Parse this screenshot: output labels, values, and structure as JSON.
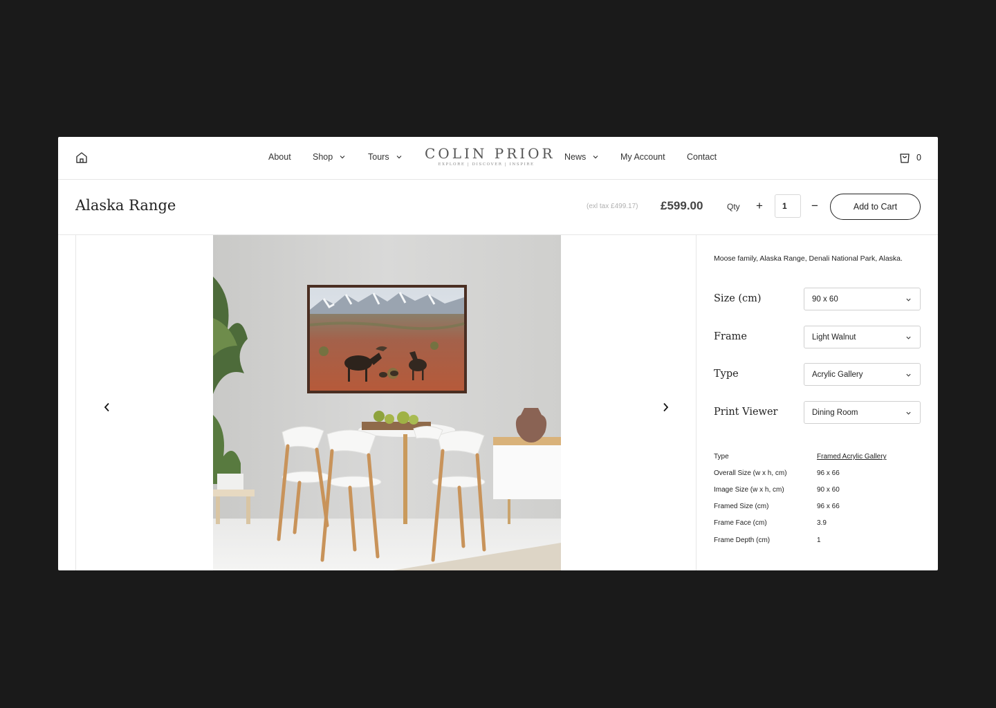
{
  "header": {
    "nav_left": [
      "About",
      "Shop",
      "Tours"
    ],
    "logo_title": "COLIN PRIOR",
    "logo_tagline": "EXPLORE | DISCOVER | INSPIRE",
    "nav_right": [
      "News",
      "My Account",
      "Contact"
    ],
    "cart_count": "0"
  },
  "product": {
    "title": "Alaska Range",
    "ex_tax": "(exl tax £499.17)",
    "price": "£599.00",
    "qty_label": "Qty",
    "qty_plus": "+",
    "qty_value": "1",
    "qty_minus": "−",
    "add_to_cart": "Add to Cart"
  },
  "sidebar": {
    "description": "Moose family, Alaska Range, Denali National Park, Alaska.",
    "options": [
      {
        "label": "Size (cm)",
        "value": "90 x 60"
      },
      {
        "label": "Frame",
        "value": "Light Walnut"
      },
      {
        "label": "Type",
        "value": "Acrylic Gallery"
      },
      {
        "label": "Print Viewer",
        "value": "Dining Room"
      }
    ],
    "specs": [
      {
        "key": "Type",
        "value": "Framed Acrylic Gallery"
      },
      {
        "key": "Overall Size (w x h, cm)",
        "value": "96 x 66"
      },
      {
        "key": "Image Size (w x h, cm)",
        "value": "90 x 60"
      },
      {
        "key": "Framed Size (cm)",
        "value": "96 x 66"
      },
      {
        "key": "Frame Face (cm)",
        "value": "3.9"
      },
      {
        "key": "Frame Depth (cm)",
        "value": "1"
      }
    ]
  },
  "icons": {
    "home": "home-icon",
    "cart": "shopping-bag-icon",
    "prev": "chevron-left-icon",
    "next": "chevron-right-icon",
    "dropdown": "chevron-down-icon"
  },
  "colors": {
    "page_background": "#1a1a1a",
    "card_background": "#ffffff",
    "text": "#222222",
    "muted": "#b0b0b0"
  }
}
